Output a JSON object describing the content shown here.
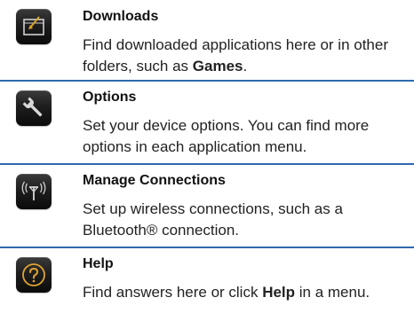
{
  "entries": [
    {
      "icon": "downloads-folder-icon",
      "title": "Downloads",
      "desc_before": "Find downloaded applications here or in other folders, such as ",
      "desc_bold": "Games",
      "desc_after": "."
    },
    {
      "icon": "wrench-icon",
      "title": "Options",
      "desc_before": "Set your device options. You can find more options in each application menu.",
      "desc_bold": "",
      "desc_after": ""
    },
    {
      "icon": "wireless-antenna-icon",
      "title": "Manage Connections",
      "desc_before": "Set up wireless connections, such as a Bluetooth® connection.",
      "desc_bold": "",
      "desc_after": ""
    },
    {
      "icon": "help-question-icon",
      "title": "Help",
      "desc_before": "Find answers here or click ",
      "desc_bold": "Help",
      "desc_after": " in a menu."
    }
  ],
  "colors": {
    "divider": "#2f69ac",
    "icon_accent": "#d9a32b"
  }
}
